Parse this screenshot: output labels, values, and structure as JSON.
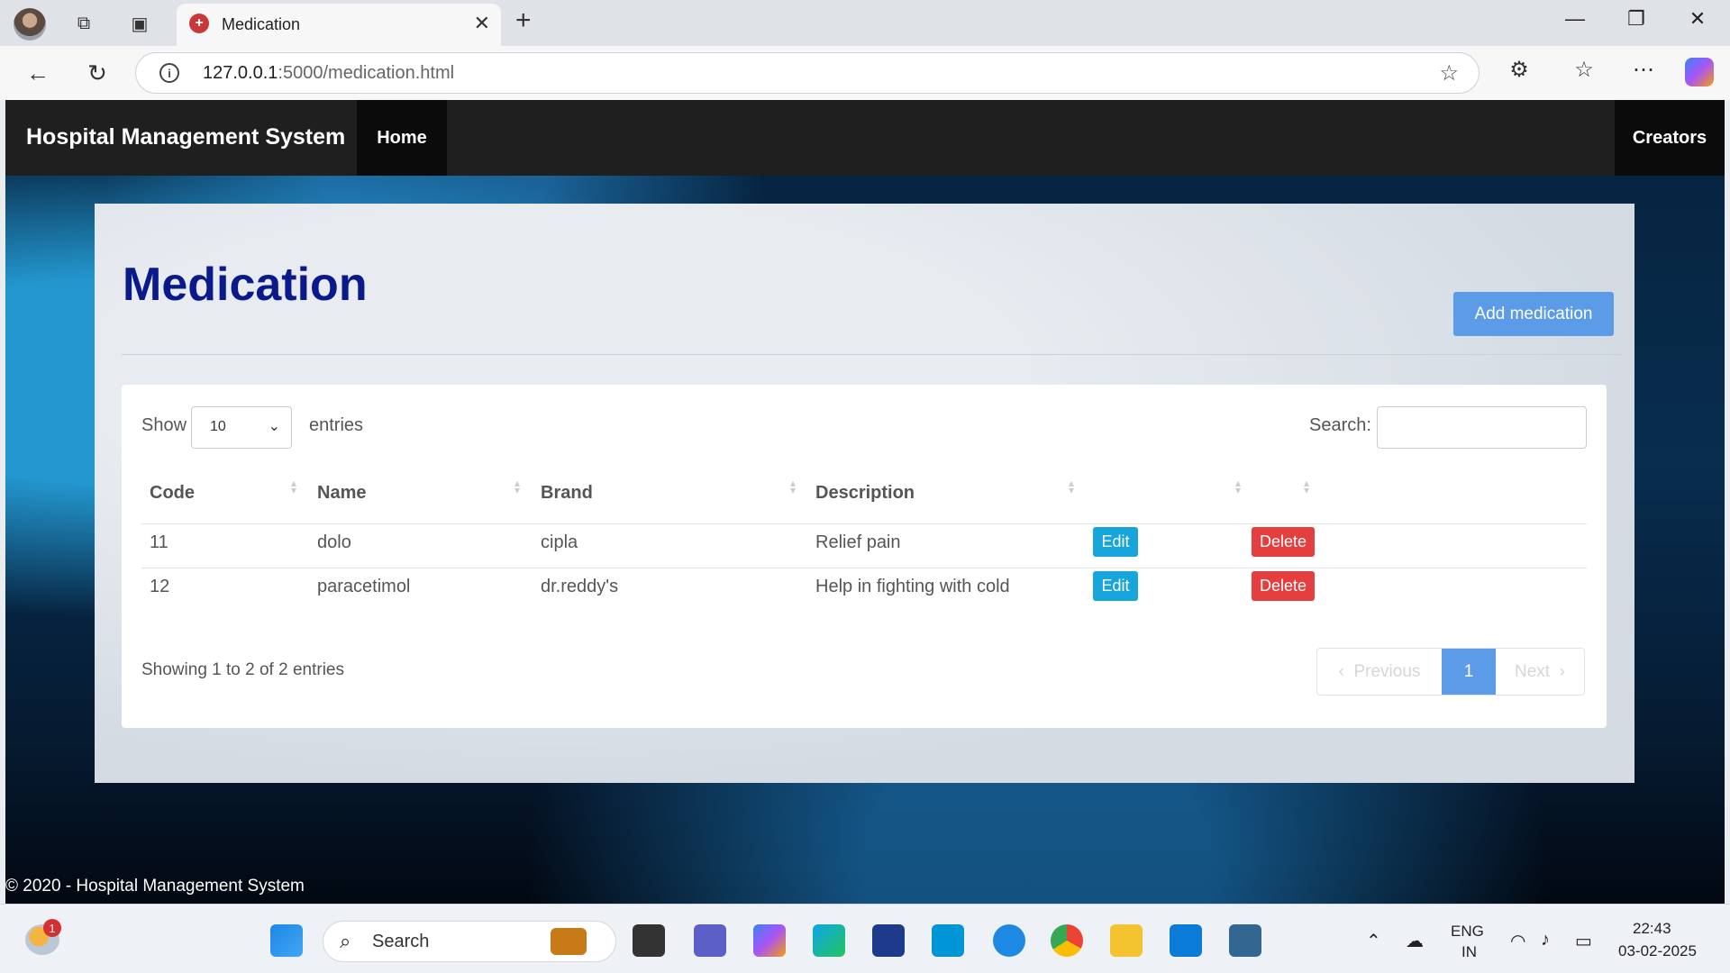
{
  "browser": {
    "tab_title": "Medication",
    "tab_close": "✕",
    "new_tab": "+",
    "url_host": "127.0.0.1",
    "url_path": ":5000/medication.html",
    "window_controls": {
      "minimize": "—",
      "restore": "❐",
      "close": "✕"
    }
  },
  "navbar": {
    "brand": "Hospital Management System",
    "home": "Home",
    "creators": "Creators"
  },
  "main": {
    "title": "Medication",
    "add_button": "Add medication",
    "show_label": "Show",
    "page_length": "10",
    "entries_label": "entries",
    "search_label": "Search:",
    "search_value": "",
    "columns": [
      "Code",
      "Name",
      "Brand",
      "Description",
      "",
      ""
    ],
    "rows": [
      {
        "code": "11",
        "name": "dolo",
        "brand": "cipla",
        "description": "Relief pain",
        "edit": "Edit",
        "delete": "Delete"
      },
      {
        "code": "12",
        "name": "paracetimol",
        "brand": "dr.reddy's",
        "description": "Help in fighting with cold",
        "edit": "Edit",
        "delete": "Delete"
      }
    ],
    "info": "Showing 1 to 2 of 2 entries",
    "pagination": {
      "previous": "Previous",
      "current": "1",
      "next": "Next"
    }
  },
  "footer": {
    "text": "© 2020 - Hospital Management System"
  },
  "taskbar": {
    "weather_badge": "1",
    "search_label": "Search",
    "language": "ENG",
    "region": "IN",
    "time": "22:43",
    "date": "03-02-2025"
  },
  "colors": {
    "accent_blue": "#5b9be8",
    "edit_button": "#17a6dc",
    "delete_button": "#e53e3e",
    "title_navy": "#0a1a8a",
    "navbar": "#1f1f1f"
  },
  "icons": [
    "profile-avatar",
    "collections-icon",
    "tab-actions-icon",
    "back-arrow-icon",
    "refresh-icon",
    "info-icon",
    "favorite-star-icon",
    "extensions-icon",
    "favorites-icon",
    "more-icon",
    "copilot-icon",
    "windows-start-icon",
    "search-icon",
    "wifi-icon",
    "volume-icon",
    "battery-icon"
  ]
}
